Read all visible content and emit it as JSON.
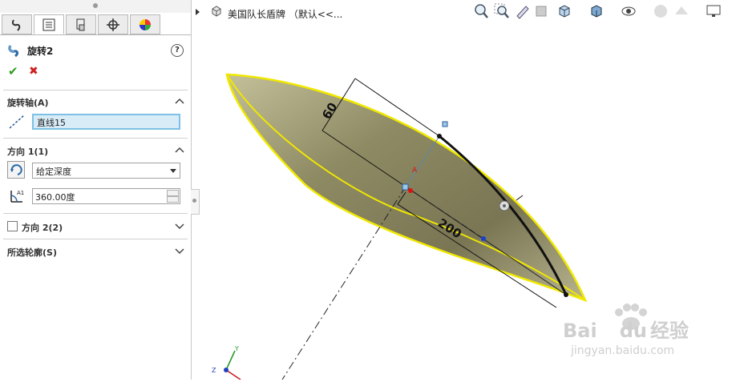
{
  "app": {
    "icon": "revolve-feature-icon"
  },
  "feature": {
    "title": "旋转2",
    "help": "?"
  },
  "actions": {
    "ok": "✔",
    "cancel": "✖"
  },
  "axis_section": {
    "header": "旋转轴(A)",
    "value": "直线15"
  },
  "direction1": {
    "header": "方向 1(1)",
    "end_condition": "给定深度",
    "angle": "360.00度"
  },
  "direction2": {
    "header": "方向 2(2)",
    "checked": false
  },
  "contours": {
    "header": "所选轮廓(S)"
  },
  "document": {
    "title": "美国队长盾牌 （默认<<..."
  },
  "dimensions": {
    "d1": "60",
    "d2": "200"
  },
  "triad": {
    "y": "Y",
    "z": "Z"
  },
  "watermark": {
    "brand": "Bai",
    "brand2": "du",
    "cn": "经验",
    "url": "jingyan.baidu.com"
  },
  "colors": {
    "surface": "#8f8a64",
    "edge": "#f0e800",
    "sketch": "#111111"
  }
}
